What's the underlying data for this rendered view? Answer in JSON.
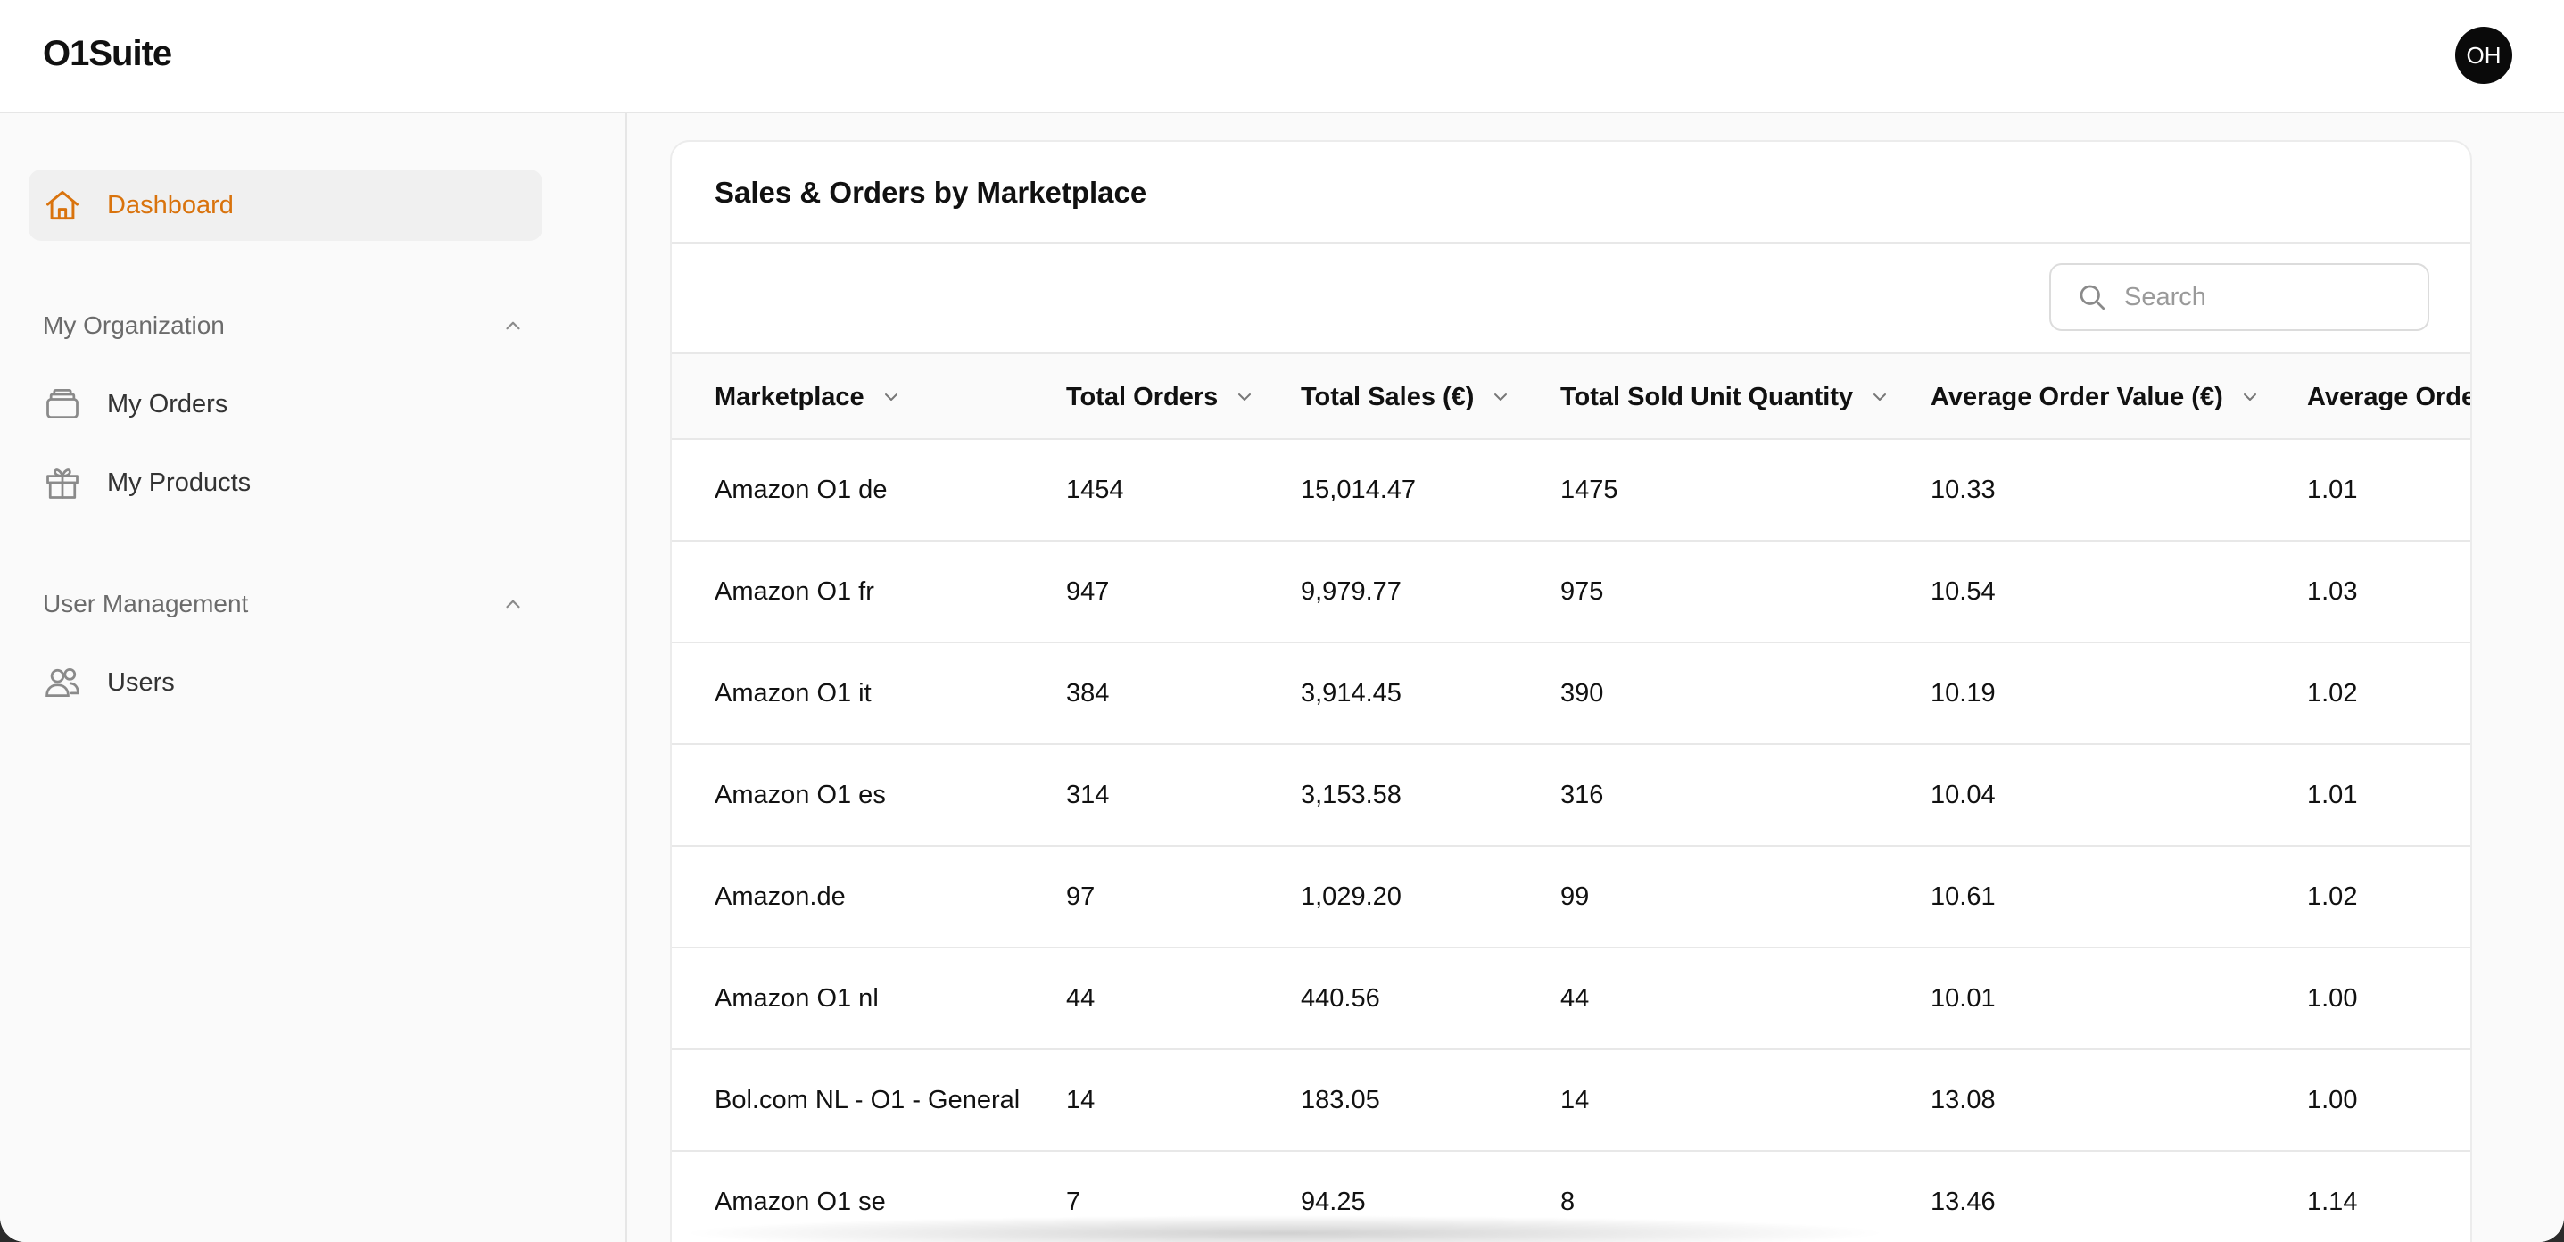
{
  "app": {
    "logo": "O1Suite",
    "avatar_initials": "OH"
  },
  "sidebar": {
    "dashboard_label": "Dashboard",
    "sections": [
      {
        "title": "My Organization",
        "items": [
          {
            "label": "My Orders",
            "icon": "orders-icon"
          },
          {
            "label": "My Products",
            "icon": "gift-icon"
          }
        ]
      },
      {
        "title": "User Management",
        "items": [
          {
            "label": "Users",
            "icon": "users-icon"
          }
        ]
      }
    ]
  },
  "main": {
    "card_title": "Sales & Orders by Marketplace",
    "search": {
      "placeholder": "Search",
      "value": ""
    },
    "columns": [
      "Marketplace",
      "Total Orders",
      "Total Sales (€)",
      "Total Sold Unit Quantity",
      "Average Order Value (€)",
      "Average Orde"
    ],
    "rows": [
      [
        "Amazon O1 de",
        "1454",
        "15,014.47",
        "1475",
        "10.33",
        "1.01"
      ],
      [
        "Amazon O1 fr",
        "947",
        "9,979.77",
        "975",
        "10.54",
        "1.03"
      ],
      [
        "Amazon O1 it",
        "384",
        "3,914.45",
        "390",
        "10.19",
        "1.02"
      ],
      [
        "Amazon O1 es",
        "314",
        "3,153.58",
        "316",
        "10.04",
        "1.01"
      ],
      [
        "Amazon.de",
        "97",
        "1,029.20",
        "99",
        "10.61",
        "1.02"
      ],
      [
        "Amazon O1 nl",
        "44",
        "440.56",
        "44",
        "10.01",
        "1.00"
      ],
      [
        "Bol.com NL - O1 - General",
        "14",
        "183.05",
        "14",
        "13.08",
        "1.00"
      ],
      [
        "Amazon O1 se",
        "7",
        "94.25",
        "8",
        "13.46",
        "1.14"
      ]
    ]
  },
  "colors": {
    "accent": "#d9730d",
    "avatar_bg": "#0a0a0a"
  }
}
